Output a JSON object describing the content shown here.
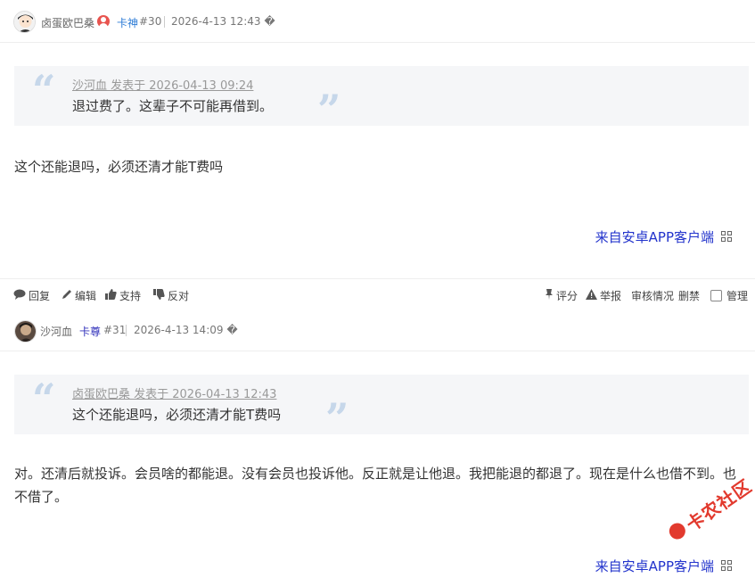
{
  "posts": [
    {
      "author": "卤蛋欧巴桑",
      "group": "卡神",
      "floor": "#30",
      "date": "2026-4-13 12:43 �",
      "quote": {
        "meta": "沙河血 发表于 2026-04-13 09:24",
        "text": "退过费了。这辈子不可能再借到。"
      },
      "message": "这个还能退吗，必须还清才能T费吗",
      "from": "来自安卓APP客户端",
      "actions": {
        "reply": "回复",
        "edit": "编辑",
        "support": "支持",
        "oppose": "反对",
        "rate": "评分",
        "report": "举报",
        "review": "审核情况",
        "ban": "删禁",
        "manage": "管理"
      }
    },
    {
      "author": "沙河血",
      "group": "卡尊",
      "floor": "#31",
      "date": "2026-4-13 14:09 �",
      "quote": {
        "meta": "卤蛋欧巴桑 发表于 2026-04-13 12:43",
        "text": "这个还能退吗，必须还清才能T费吗"
      },
      "message": "对。还清后就投诉。会员啥的都能退。没有会员也投诉他。反正就是让他退。我把能退的都退了。现在是什么也借不到。也不借了。",
      "from": "来自安卓APP客户端"
    }
  ],
  "watermark": "卡农社区",
  "colors": {
    "accent_blue": "#2b7bd6",
    "link_blue": "#2233cc",
    "quote_bg": "#f5f6f8",
    "watermark_red": "#e23a2e"
  }
}
